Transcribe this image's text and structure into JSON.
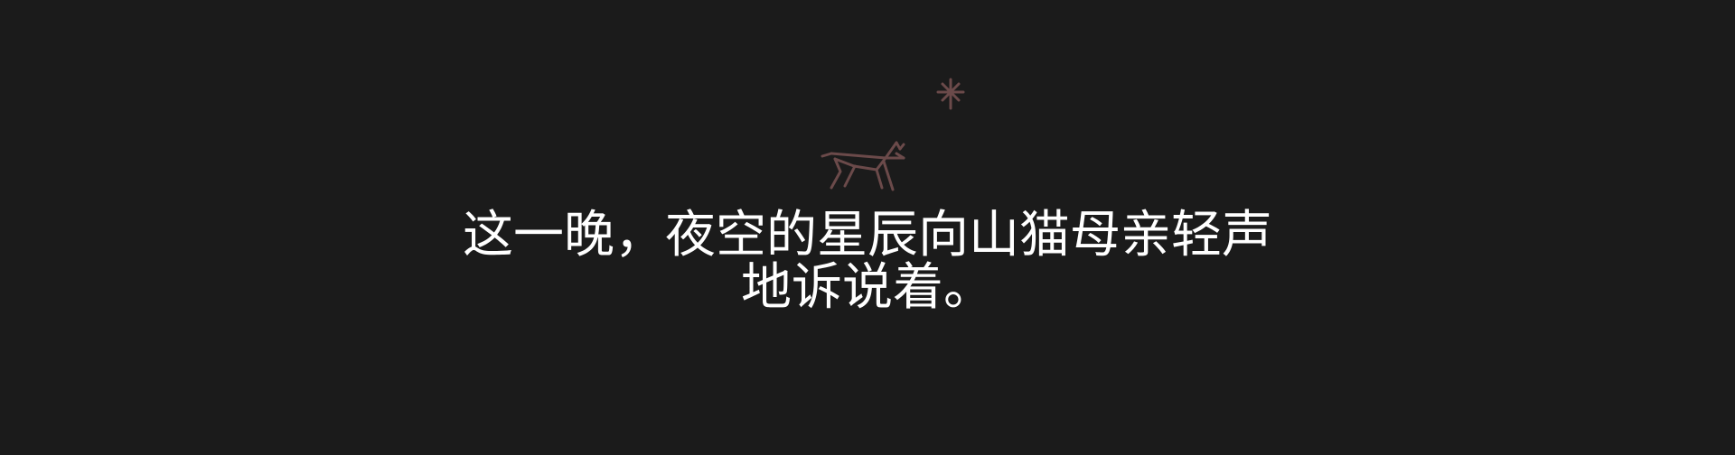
{
  "story": {
    "lines": [
      "这一晚，夜空的星辰向山猫母亲轻声",
      "地诉说着。"
    ]
  },
  "illustration": {
    "star_icon": "sparkle-star-icon",
    "animal_icon": "lynx-line-icon",
    "stroke_color": "#6b4a4a"
  },
  "theme": {
    "background": "#1b1b1b",
    "text_color": "#ffffff"
  }
}
